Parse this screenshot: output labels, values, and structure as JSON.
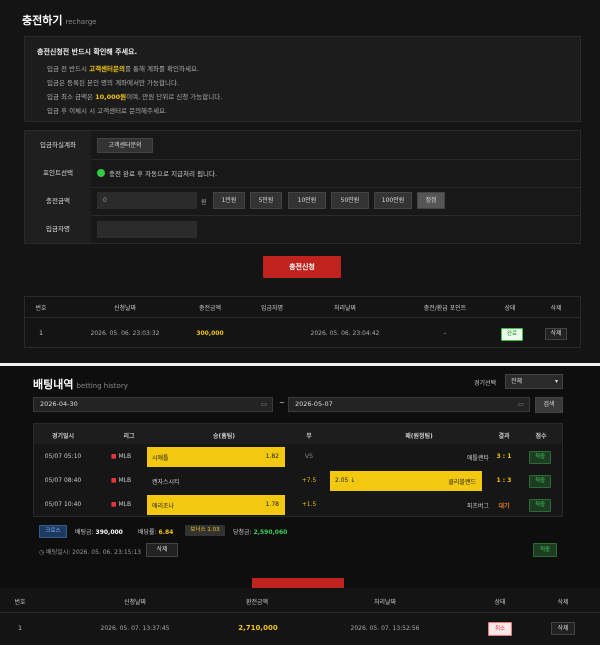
{
  "recharge": {
    "title": "충전하기",
    "subtitle": "recharge",
    "notice": {
      "heading": "충전신청전 반드시 확인해 주세요.",
      "line1_pre": "입금 전 반드시 ",
      "line1_hl": "고객센터문의",
      "line1_post": "를 통해 계좌를 확인하세요.",
      "line2": "입금은 등록된 본인 명의 계좌에서만 가능합니다.",
      "line3_pre": "입금 최소 금액은 ",
      "line3_hl": "10,000원",
      "line3_post": "이며, 만원 단위로 신청 가능합니다.",
      "line4": "입금 후 이체시 시 고객센터로 문의해주세요."
    },
    "form": {
      "account_label": "입금하실계좌",
      "account_button": "고객센터문의",
      "point_label": "포인트선택",
      "point_text": "충전 완료 후 자동으로 지급처리 됩니다.",
      "amount_label": "충전금액",
      "amount_value": "0",
      "amount_unit": "원",
      "amount_buttons": [
        "1만원",
        "5만원",
        "10만원",
        "50만원",
        "100만원",
        "정정"
      ],
      "depositor_label": "입금자명"
    },
    "submit": "충전신청",
    "table": {
      "headers": [
        "번호",
        "신청날짜",
        "충전금액",
        "입금자명",
        "처리날짜",
        "충전/환급 포인트",
        "상태",
        "삭제"
      ],
      "row": {
        "no": "1",
        "req_date": "2026. 05. 06. 23:03:32",
        "amount": "300,000",
        "proc_date": "2026. 05. 06. 23:04:42",
        "point": "-",
        "status": "완료",
        "delete": "삭제"
      }
    }
  },
  "betting": {
    "title": "배팅내역",
    "subtitle": "betting history",
    "filter_label": "경기선택",
    "filter_value": "전체",
    "date_from": "2026-04-30",
    "tilde": "~",
    "date_to": "2026-05-07",
    "search": "검색",
    "headers": [
      "경기일시",
      "리그",
      "승(홈팀)",
      "무",
      "패(원정팀)",
      "결과",
      "점수"
    ],
    "games": [
      {
        "time": "05/07 05:10",
        "league": "MLB",
        "home": "시애틀",
        "home_odds": "1.82",
        "draw": "VS",
        "away_odds": "",
        "away": "애틀랜타",
        "score": "3 : 1",
        "result": "적중"
      },
      {
        "time": "05/07 08:40",
        "league": "MLB",
        "home": "캔자스시티",
        "home_odds": "",
        "draw": "+7.5",
        "away_odds": "2.05 ↓",
        "away": "클리블랜드",
        "score": "1 : 3",
        "result": "적중"
      },
      {
        "time": "05/07 10:40",
        "league": "MLB",
        "home": "애리조나",
        "home_odds": "1.78",
        "draw": "+1.5",
        "away_odds": "",
        "away": "피츠버그",
        "score": "대기",
        "result": "적중"
      }
    ],
    "summary": {
      "type": "크로스",
      "bet_label": "배팅금:",
      "bet_value": "390,000",
      "odds_label": "배당률:",
      "odds_value": "6.84",
      "bonus": "보너스 1.03",
      "win_label": "당첨금:",
      "win_value": "2,590,060",
      "result": "적중"
    },
    "bet_time": "배팅일시: 2026. 05. 06. 23:15:13",
    "delete": "삭제"
  },
  "withdraw": {
    "headers": [
      "번호",
      "신청날짜",
      "환전금액",
      "처리날짜",
      "상태",
      "삭제"
    ],
    "row": {
      "no": "1",
      "req_date": "2026. 05. 07. 13:37:45",
      "amount": "2,710,000",
      "proc_date": "2026. 05. 07. 13:52:56",
      "status": "취소",
      "delete": "삭제"
    }
  }
}
